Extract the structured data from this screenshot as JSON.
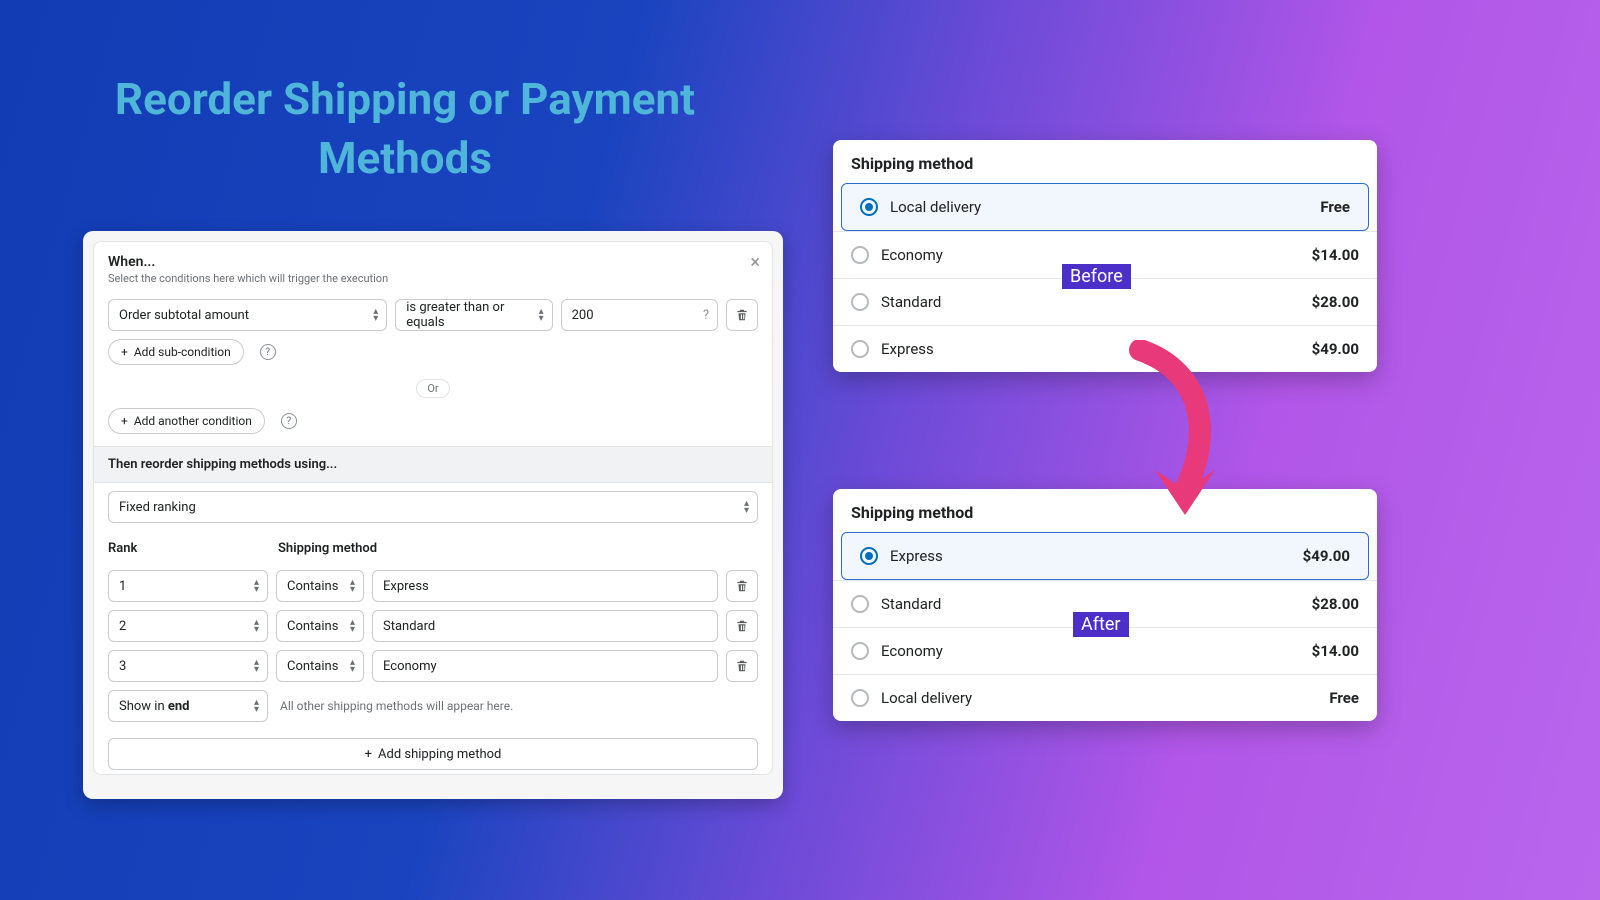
{
  "title": "Reorder Shipping or Payment Methods",
  "admin": {
    "when_title": "When...",
    "when_desc": "Select the conditions here which will trigger the execution",
    "close": "×",
    "field_select": "Order subtotal amount",
    "operator_select": "is greater than or equals",
    "value_input": "200",
    "add_sub": "Add sub-condition",
    "or": "Or",
    "add_another": "Add another condition",
    "then_title": "Then reorder shipping methods using...",
    "ranking_select": "Fixed ranking",
    "col_rank": "Rank",
    "col_method": "Shipping method",
    "rows": [
      {
        "rank": "1",
        "op": "Contains",
        "val": "Express"
      },
      {
        "rank": "2",
        "op": "Contains",
        "val": "Standard"
      },
      {
        "rank": "3",
        "op": "Contains",
        "val": "Economy"
      }
    ],
    "show_in_end": "Show in end",
    "show_in_end_hint": "All other shipping methods will appear here.",
    "add_method": "Add shipping method",
    "plus": "+"
  },
  "before": {
    "header": "Shipping method",
    "badge": "Before",
    "items": [
      {
        "name": "Local delivery",
        "price": "Free",
        "selected": true
      },
      {
        "name": "Economy",
        "price": "$14.00",
        "selected": false
      },
      {
        "name": "Standard",
        "price": "$28.00",
        "selected": false
      },
      {
        "name": "Express",
        "price": "$49.00",
        "selected": false
      }
    ]
  },
  "after": {
    "header": "Shipping method",
    "badge": "After",
    "items": [
      {
        "name": "Express",
        "price": "$49.00",
        "selected": true
      },
      {
        "name": "Standard",
        "price": "$28.00",
        "selected": false
      },
      {
        "name": "Economy",
        "price": "$14.00",
        "selected": false
      },
      {
        "name": "Local delivery",
        "price": "Free",
        "selected": false
      }
    ]
  },
  "colors": {
    "badge_bg": "#4c2fc9",
    "arrow": "#e8397a"
  }
}
